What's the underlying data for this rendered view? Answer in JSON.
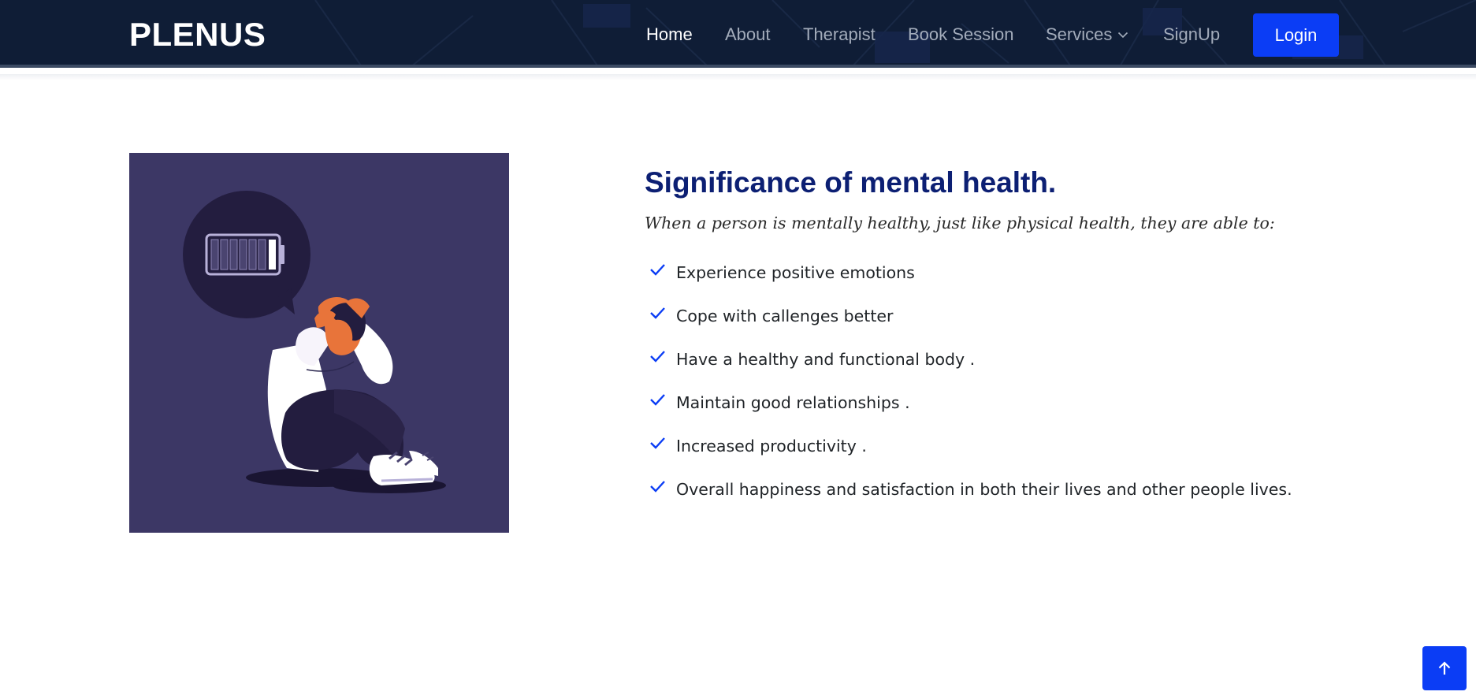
{
  "brand": {
    "name": "PLENUS"
  },
  "nav": {
    "items": [
      {
        "label": "Home",
        "active": true
      },
      {
        "label": "About",
        "active": false
      },
      {
        "label": "Therapist",
        "active": false
      },
      {
        "label": "Book Session",
        "active": false
      },
      {
        "label": "Services",
        "active": false,
        "has_dropdown": true
      },
      {
        "label": "SignUp",
        "active": false
      }
    ],
    "login_label": "Login",
    "dropdown_icon": "chevron-down-icon"
  },
  "section": {
    "title": "Significance of mental health.",
    "subtitle": "When a person is mentally healthy, just like physical health, they are able to:",
    "bullet_icon": "check-icon",
    "bullets": [
      "Experience positive emotions",
      "Cope with callenges better",
      "Have a healthy and functional body .",
      "Maintain good relationships .",
      "Increased productivity .",
      "Overall happiness and satisfaction in both their lives and other people lives."
    ]
  },
  "illustration": {
    "icon": "stressed-person-low-battery-illustration",
    "battery_level": 0.14
  },
  "back_to_top": {
    "icon": "arrow-up-icon"
  },
  "colors": {
    "header_bg": "#0f1d36",
    "accent": "#0b3df5",
    "heading": "#0c1f73",
    "illustration_bg": "#3c3765",
    "nav_inactive": "#a3acbb"
  }
}
